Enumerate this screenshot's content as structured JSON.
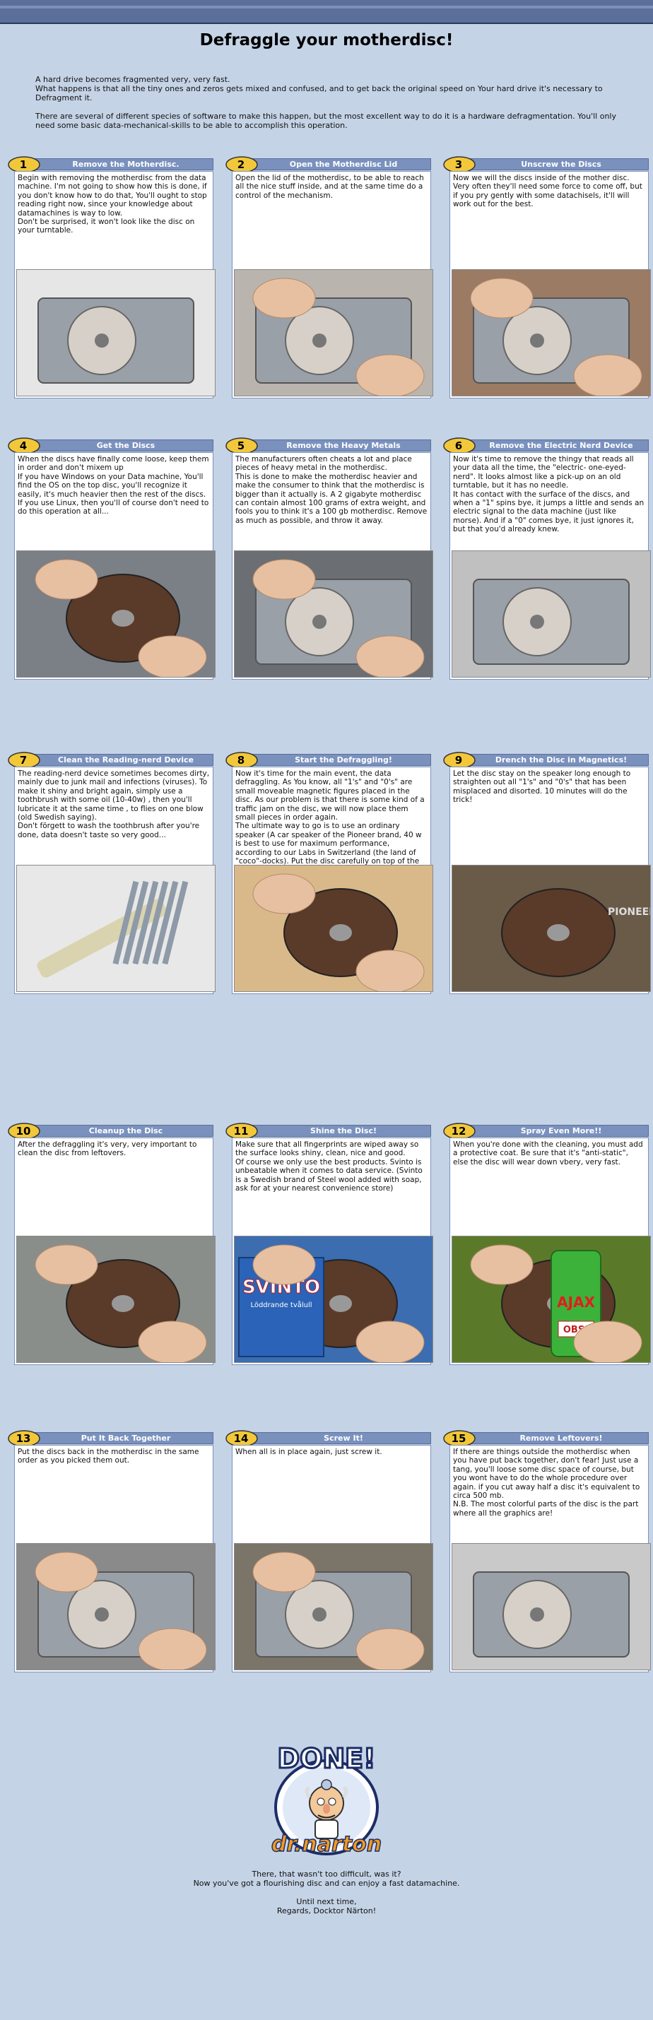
{
  "page": {
    "title": "Defraggle your motherdisc!",
    "intro": [
      "A hard drive becomes fragmented very, very fast.",
      "What happens is that all the tiny ones and zeros gets mixed and confused, and to get back the original speed on Your hard drive it's necessary to Defragment it.",
      "There are several of different species of software to make this happen, but the most excellent way to do it is a hardware defragmentation. You'll only need some basic data-mechanical-skills to be able to accomplish this operation."
    ]
  },
  "steps": [
    {
      "num": "1",
      "title": "Remove the Motherdisc.",
      "text": "Begin with removing the motherdisc from the data machine. I'm not going to show how this is done, if you don't know how to do that, You'll ought to stop reading right now, since your knowledge about datamachines is way to low.\nDon't be surprised, it won't look like the disc on your turntable."
    },
    {
      "num": "2",
      "title": "Open the Motherdisc Lid",
      "text": "Open the lid of the motherdisc, to be able to reach all the nice stuff inside, and at the same time do a control of the mechanism."
    },
    {
      "num": "3",
      "title": "Unscrew the Discs",
      "text": "Now we will the discs inside of the mother disc. Very often they'll need some force to come off, but if you pry gently with some datachisels, it'll will work out for the best."
    },
    {
      "num": "4",
      "title": "Get the Discs",
      "text": "When the discs have finally come loose, keep them in order and don't mixem up\nIf you have Windows on your Data machine, You'll find the OS on the top disc, you'll recognize it easily, it's much heavier then the rest of the discs. If you use Linux, then you'll of course don't need to do this operation at all..."
    },
    {
      "num": "5",
      "title": "Remove the Heavy Metals",
      "text": "The manufacturers often cheats a lot and place pieces of heavy metal in the motherdisc.\nThis is done to make the motherdisc heavier and make the consumer to think that the motherdisc is bigger than it actually is. A 2 gigabyte motherdisc can contain almost 100 grams of extra weight, and fools you to think it's a 100 gb motherdisc. Remove as much as possible, and throw it away."
    },
    {
      "num": "6",
      "title": "Remove the Electric Nerd Device",
      "text": "Now it's time to remove the thingy that reads all your data all the time, the \"electric- one-eyed-nerd\". It looks almost like a pick-up on an old turntable, but it has no needle.\nIt has contact with the surface of the discs, and when a \"1\" spins bye, it jumps a little and sends an electric signal to the data machine (just like morse). And if a \"0\" comes bye, it just ignores it, but that you'd already knew."
    },
    {
      "num": "7",
      "title": "Clean the Reading-nerd Device",
      "text": "The reading-nerd device sometimes becomes dirty, mainly due to junk mail and infections (viruses). To make it shiny and bright again, simply use a toothbrush with some oil (10-40w) , then you'll lubricate it at the same time , to flies on one blow (old Swedish saying).\nDon't förgett to wash the toothbrush after you're done, data doesn't taste so very good..."
    },
    {
      "num": "8",
      "title": "Start the Defraggling!",
      "text": "Now it's time for the main event, the data defraggling. As You know, all \"1's\" and \"0's\" are small moveable magnetic figures placed in the disc. As our problem is that there is some kind of a traffic jam on the disc, we will now place them small pieces in order again.\nThe ultimate way to go is to use an ordinary speaker (A car speaker of the Pioneer brand, 40 w is best to use for maximum performance, according to our Labs in Switzerland (the land of \"coco\"-docks). Put the disc carefully on top of the speaker. Be sure not do any violent moves, we don't want the magnetic pieces to go beezerk."
    },
    {
      "num": "9",
      "title": "Drench the Disc in Magnetics!",
      "text": "Let the disc stay on the speaker long enough to straighten out all \"1's\" and \"0's\" that has been misplaced and disorted. 10 minutes will do the trick!"
    },
    {
      "num": "10",
      "title": "Cleanup the Disc",
      "text": "After the defraggling it's very, very important to clean the disc from leftovers."
    },
    {
      "num": "11",
      "title": "Shine the Disc!",
      "text": "Make sure that all fingerprints are wiped away so the surface looks shiny, clean, nice and good.\nOf course we only use the best products. Svinto is unbeatable when it comes to data service. (Svinto is a Swedish brand of Steel wool added with soap, ask for at your nearest convenience store)"
    },
    {
      "num": "12",
      "title": "Spray Even More!!",
      "text": "When you're done with the cleaning, you must add a protective coat. Be sure that it's \"anti-static\", else the disc will wear down vbery, very fast."
    },
    {
      "num": "13",
      "title": "Put It Back Together",
      "text": "Put the discs back in the motherdisc in the same order as you picked them out."
    },
    {
      "num": "14",
      "title": "Screw It!",
      "text": "When all is in place again, just screw it."
    },
    {
      "num": "15",
      "title": "Remove Leftovers!",
      "text": "If there are things outside the motherdisc when you have put back together, don't fear! Just use a tang, you'll loose some disc space of course, but you wont have to do the whole procedure over again. if you cut away half a disc it's equivalent to circa 500 mb.\nN.B. The most colorful parts of the disc is the part where all the graphics are!"
    }
  ],
  "logo": {
    "done": "DONE!",
    "brand": "dr.narton"
  },
  "photo_labels": {
    "svinto": "SVINTO",
    "svinto_sub": "Löddrande tvålull",
    "ajax": "AJAX",
    "obs": "OBS!",
    "pioneer": "PIONEER"
  },
  "ending": [
    "There, that wasn't too difficult, was it?\nNow you've got a flourishing disc and can enjoy a fast datamachine.",
    "Until next time,\nRegards, Docktor Närton!"
  ],
  "colors": {
    "background": "#c5d3e6",
    "header_bar": "#7a91be",
    "badge": "#f2c83a",
    "logo_orange": "#f29a20"
  }
}
